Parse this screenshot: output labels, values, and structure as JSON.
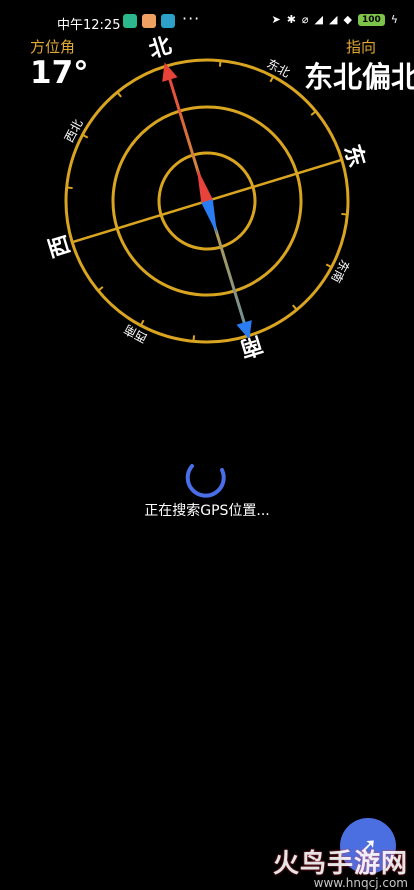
{
  "status_bar": {
    "time": "中午12:25",
    "battery": "100"
  },
  "header": {
    "azimuth_label": "方位角",
    "azimuth_value": "17°",
    "direction_label": "指向",
    "direction_value": "东北偏北"
  },
  "compass": {
    "north": "北",
    "south": "南",
    "east": "东",
    "west": "西",
    "northeast": "东北",
    "northwest": "西北",
    "southeast": "东南",
    "southwest": "西南",
    "heading_degrees": 17
  },
  "loading": {
    "text": "正在搜索GPS位置..."
  },
  "fab": {
    "icon": "location-icon"
  },
  "watermark": {
    "text": "火鸟手游网",
    "url": "www.hnqcj.com"
  },
  "colors": {
    "accent_gold": "#e1a934",
    "north_red": "#e8433a",
    "south_blue": "#2a7cf2",
    "fab_blue": "#4b6fe0"
  }
}
